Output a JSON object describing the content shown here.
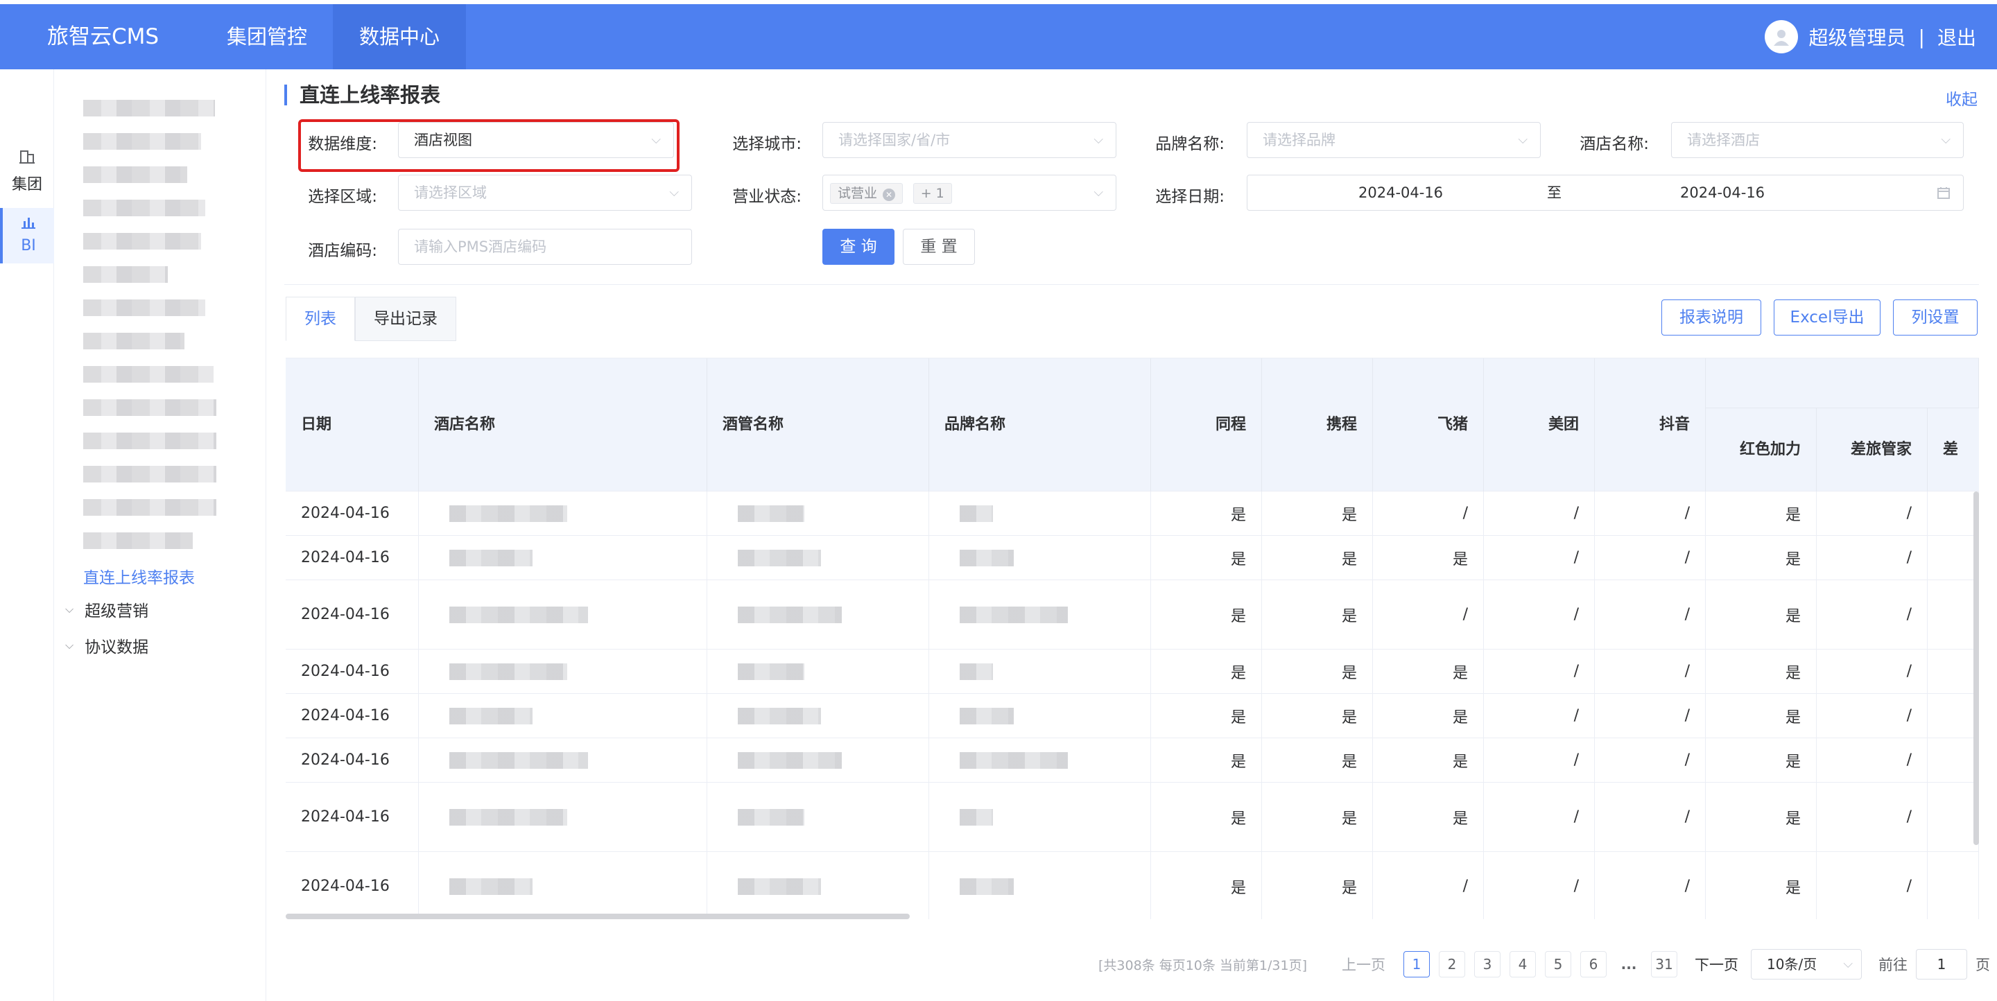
{
  "topbar": {
    "brand": "旅智云CMS",
    "nav": [
      "集团管控",
      "数据中心"
    ],
    "user": "超级管理员",
    "separator": "|",
    "logout": "退出"
  },
  "rail": {
    "group": "集团",
    "bi": "BI"
  },
  "menu": {
    "active_item": "直连上线率报表",
    "groups": [
      "超级营销",
      "协议数据"
    ]
  },
  "page": {
    "title": "直连上线率报表",
    "collapse": "收起"
  },
  "filters": {
    "dimension": {
      "label": "数据维度:",
      "value": "酒店视图"
    },
    "city": {
      "label": "选择城市:",
      "placeholder": "请选择国家/省/市"
    },
    "brand": {
      "label": "品牌名称:",
      "placeholder": "请选择品牌"
    },
    "hotel": {
      "label": "酒店名称:",
      "placeholder": "请选择酒店"
    },
    "region": {
      "label": "选择区域:",
      "placeholder": "请选择区域"
    },
    "status": {
      "label": "营业状态:",
      "tag": "试营业",
      "more": "+ 1"
    },
    "date": {
      "label": "选择日期:",
      "start": "2024-04-16",
      "to": "至",
      "end": "2024-04-16"
    },
    "code": {
      "label": "酒店编码:",
      "placeholder": "请输入PMS酒店编码"
    }
  },
  "buttons": {
    "query": "查 询",
    "reset": "重 置",
    "explain": "报表说明",
    "excel": "Excel导出",
    "columns": "列设置"
  },
  "tabs": [
    "列表",
    "导出记录"
  ],
  "table": {
    "headers": [
      "日期",
      "酒店名称",
      "酒管名称",
      "品牌名称",
      "同程",
      "携程",
      "飞猪",
      "美团",
      "抖音",
      "红色加力",
      "差旅管家",
      "差"
    ],
    "rows": [
      [
        "2024-04-16",
        "是",
        "是",
        "/",
        "/",
        "/",
        "是",
        "/"
      ],
      [
        "2024-04-16",
        "是",
        "是",
        "是",
        "/",
        "/",
        "是",
        "/"
      ],
      [
        "2024-04-16",
        "是",
        "是",
        "/",
        "/",
        "/",
        "是",
        "/"
      ],
      [
        "2024-04-16",
        "是",
        "是",
        "是",
        "/",
        "/",
        "是",
        "/"
      ],
      [
        "2024-04-16",
        "是",
        "是",
        "是",
        "/",
        "/",
        "是",
        "/"
      ],
      [
        "2024-04-16",
        "是",
        "是",
        "是",
        "/",
        "/",
        "是",
        "/"
      ],
      [
        "2024-04-16",
        "是",
        "是",
        "是",
        "/",
        "/",
        "是",
        "/"
      ],
      [
        "2024-04-16",
        "是",
        "是",
        "/",
        "/",
        "/",
        "是",
        "/"
      ]
    ]
  },
  "pagination": {
    "summary": "[共308条 每页10条 当前第1/31页]",
    "prev": "上一页",
    "pages": [
      "1",
      "2",
      "3",
      "4",
      "5",
      "6",
      "...",
      "31"
    ],
    "next": "下一页",
    "page_size": "10条/页",
    "goto": "前往",
    "goto_value": "1",
    "page_unit": "页"
  }
}
